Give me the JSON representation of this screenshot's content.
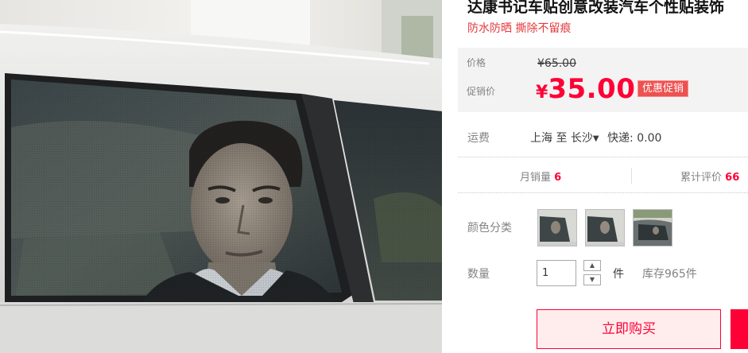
{
  "product": {
    "title": "达康书记车贴创意改装汽车个性贴装饰",
    "subtitle": "防水防晒 撕除不留痕",
    "photo_alt": "达康书记车窗贴效果图"
  },
  "price": {
    "orig_label": "价格",
    "orig_value": "¥65.00",
    "promo_label": "促销价",
    "currency": "¥",
    "promo_value": "35.00",
    "promo_badge": "优惠促销"
  },
  "shipping": {
    "label": "运费",
    "from": "上海",
    "to_word": "至",
    "to": "长沙",
    "method": "快递: 0.00"
  },
  "stats": {
    "monthly_sales_label": "月销量",
    "monthly_sales_value": "6",
    "reviews_label": "累计评价",
    "reviews_value": "66"
  },
  "color": {
    "label": "颜色分类",
    "options": [
      "option-1",
      "option-2",
      "option-3"
    ]
  },
  "quantity": {
    "label": "数量",
    "value": "1",
    "unit": "件",
    "stock": "库存965件"
  },
  "actions": {
    "buy_now": "立即购买"
  },
  "colors": {
    "accent": "#ff0036",
    "price_bg": "#f3f3f3",
    "badge_bg": "#ec5250"
  }
}
